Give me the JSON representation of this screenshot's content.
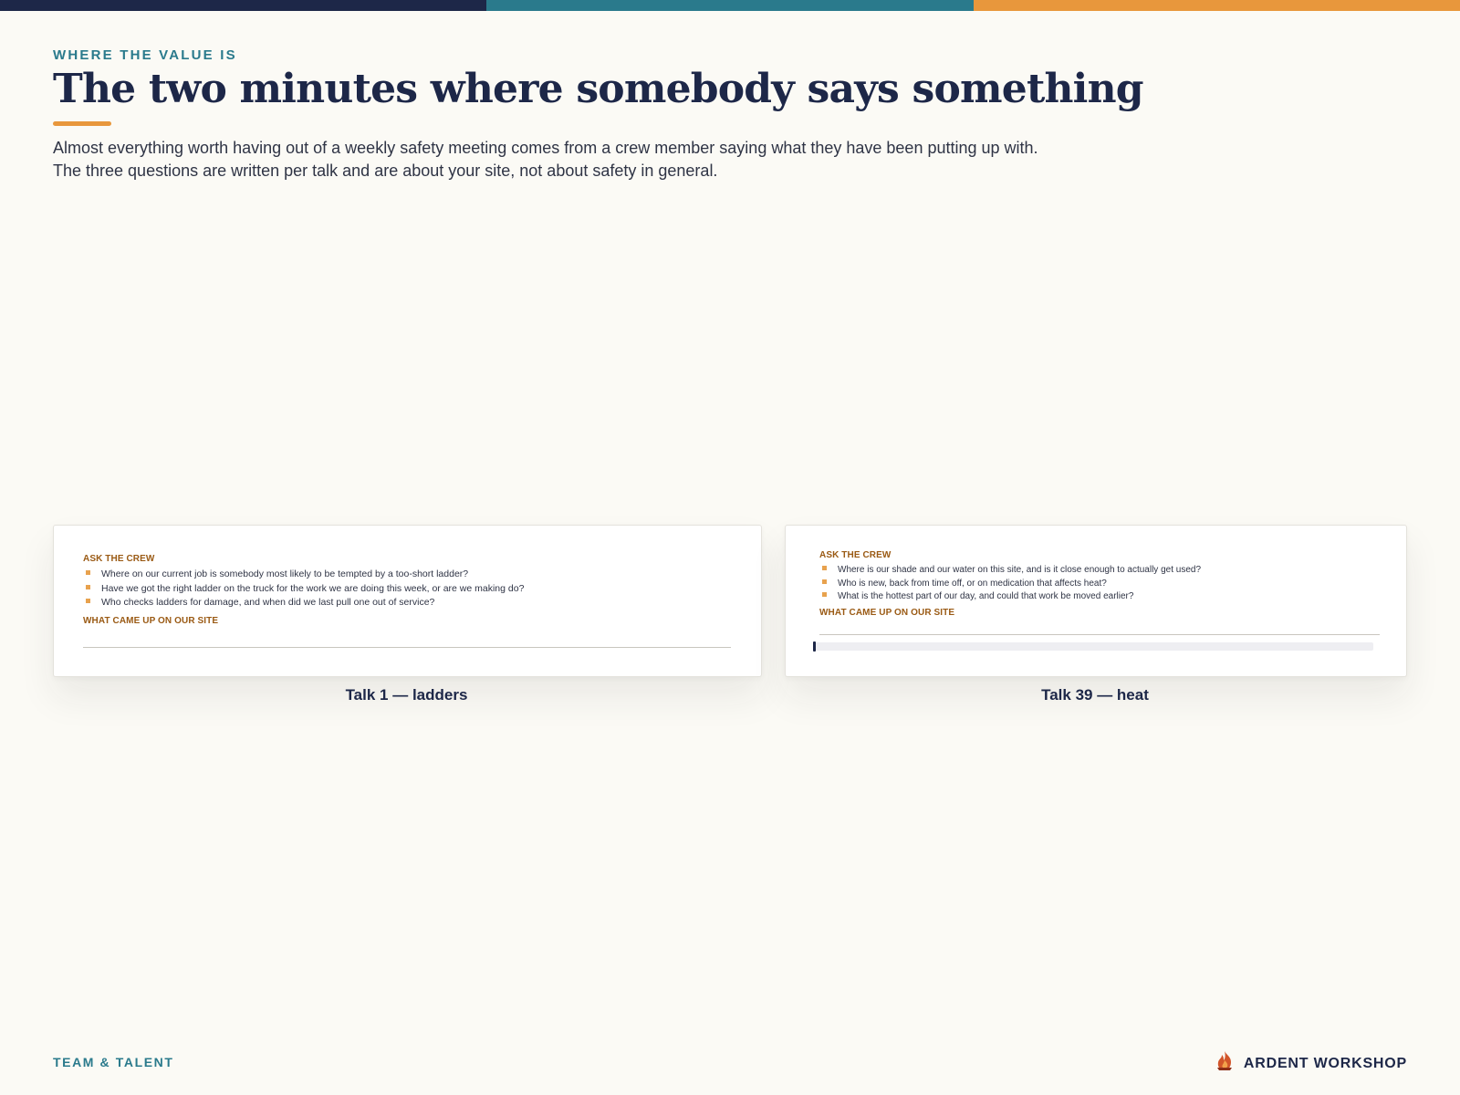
{
  "colors": {
    "navy": "#1d2748",
    "teal": "#2a7a8c",
    "orange": "#e8973c",
    "background": "#fbfaf5",
    "label_brown": "#9a5a14"
  },
  "topbar": [
    "#1d2748",
    "#2a7a8c",
    "#e8973c"
  ],
  "header": {
    "kicker": "WHERE THE VALUE IS",
    "title": "The two minutes where somebody says something",
    "intro_line_1": "Almost everything worth having out of a weekly safety meeting comes from a crew member saying what they have been putting up with.",
    "intro_line_2": "The three questions are written per talk and are about your site, not about safety in general."
  },
  "cards": [
    {
      "ask_label": "ASK THE CREW",
      "questions": [
        "Where on our current job is somebody most likely to be tempted by a too-short ladder?",
        "Have we got the right ladder on the truck for the work we are doing this week, or are we making do?",
        "Who checks ladders for damage, and when did we last pull one out of service?"
      ],
      "came_up_label": "WHAT CAME UP ON OUR SITE",
      "caption": "Talk 1 — ladders"
    },
    {
      "ask_label": "ASK THE CREW",
      "questions": [
        "Where is our shade and our water on this site, and is it close enough to actually get used?",
        "Who is new, back from time off, or on medication that affects heat?",
        "What is the hottest part of our day, and could that work be moved earlier?"
      ],
      "came_up_label": "WHAT CAME UP ON OUR SITE",
      "progress": 0.005,
      "caption": "Talk 39 — heat"
    }
  ],
  "footer": {
    "section": "TEAM & TALENT",
    "brand": "ARDENT WORKSHOP",
    "brand_icon": "flame-logo-icon"
  }
}
